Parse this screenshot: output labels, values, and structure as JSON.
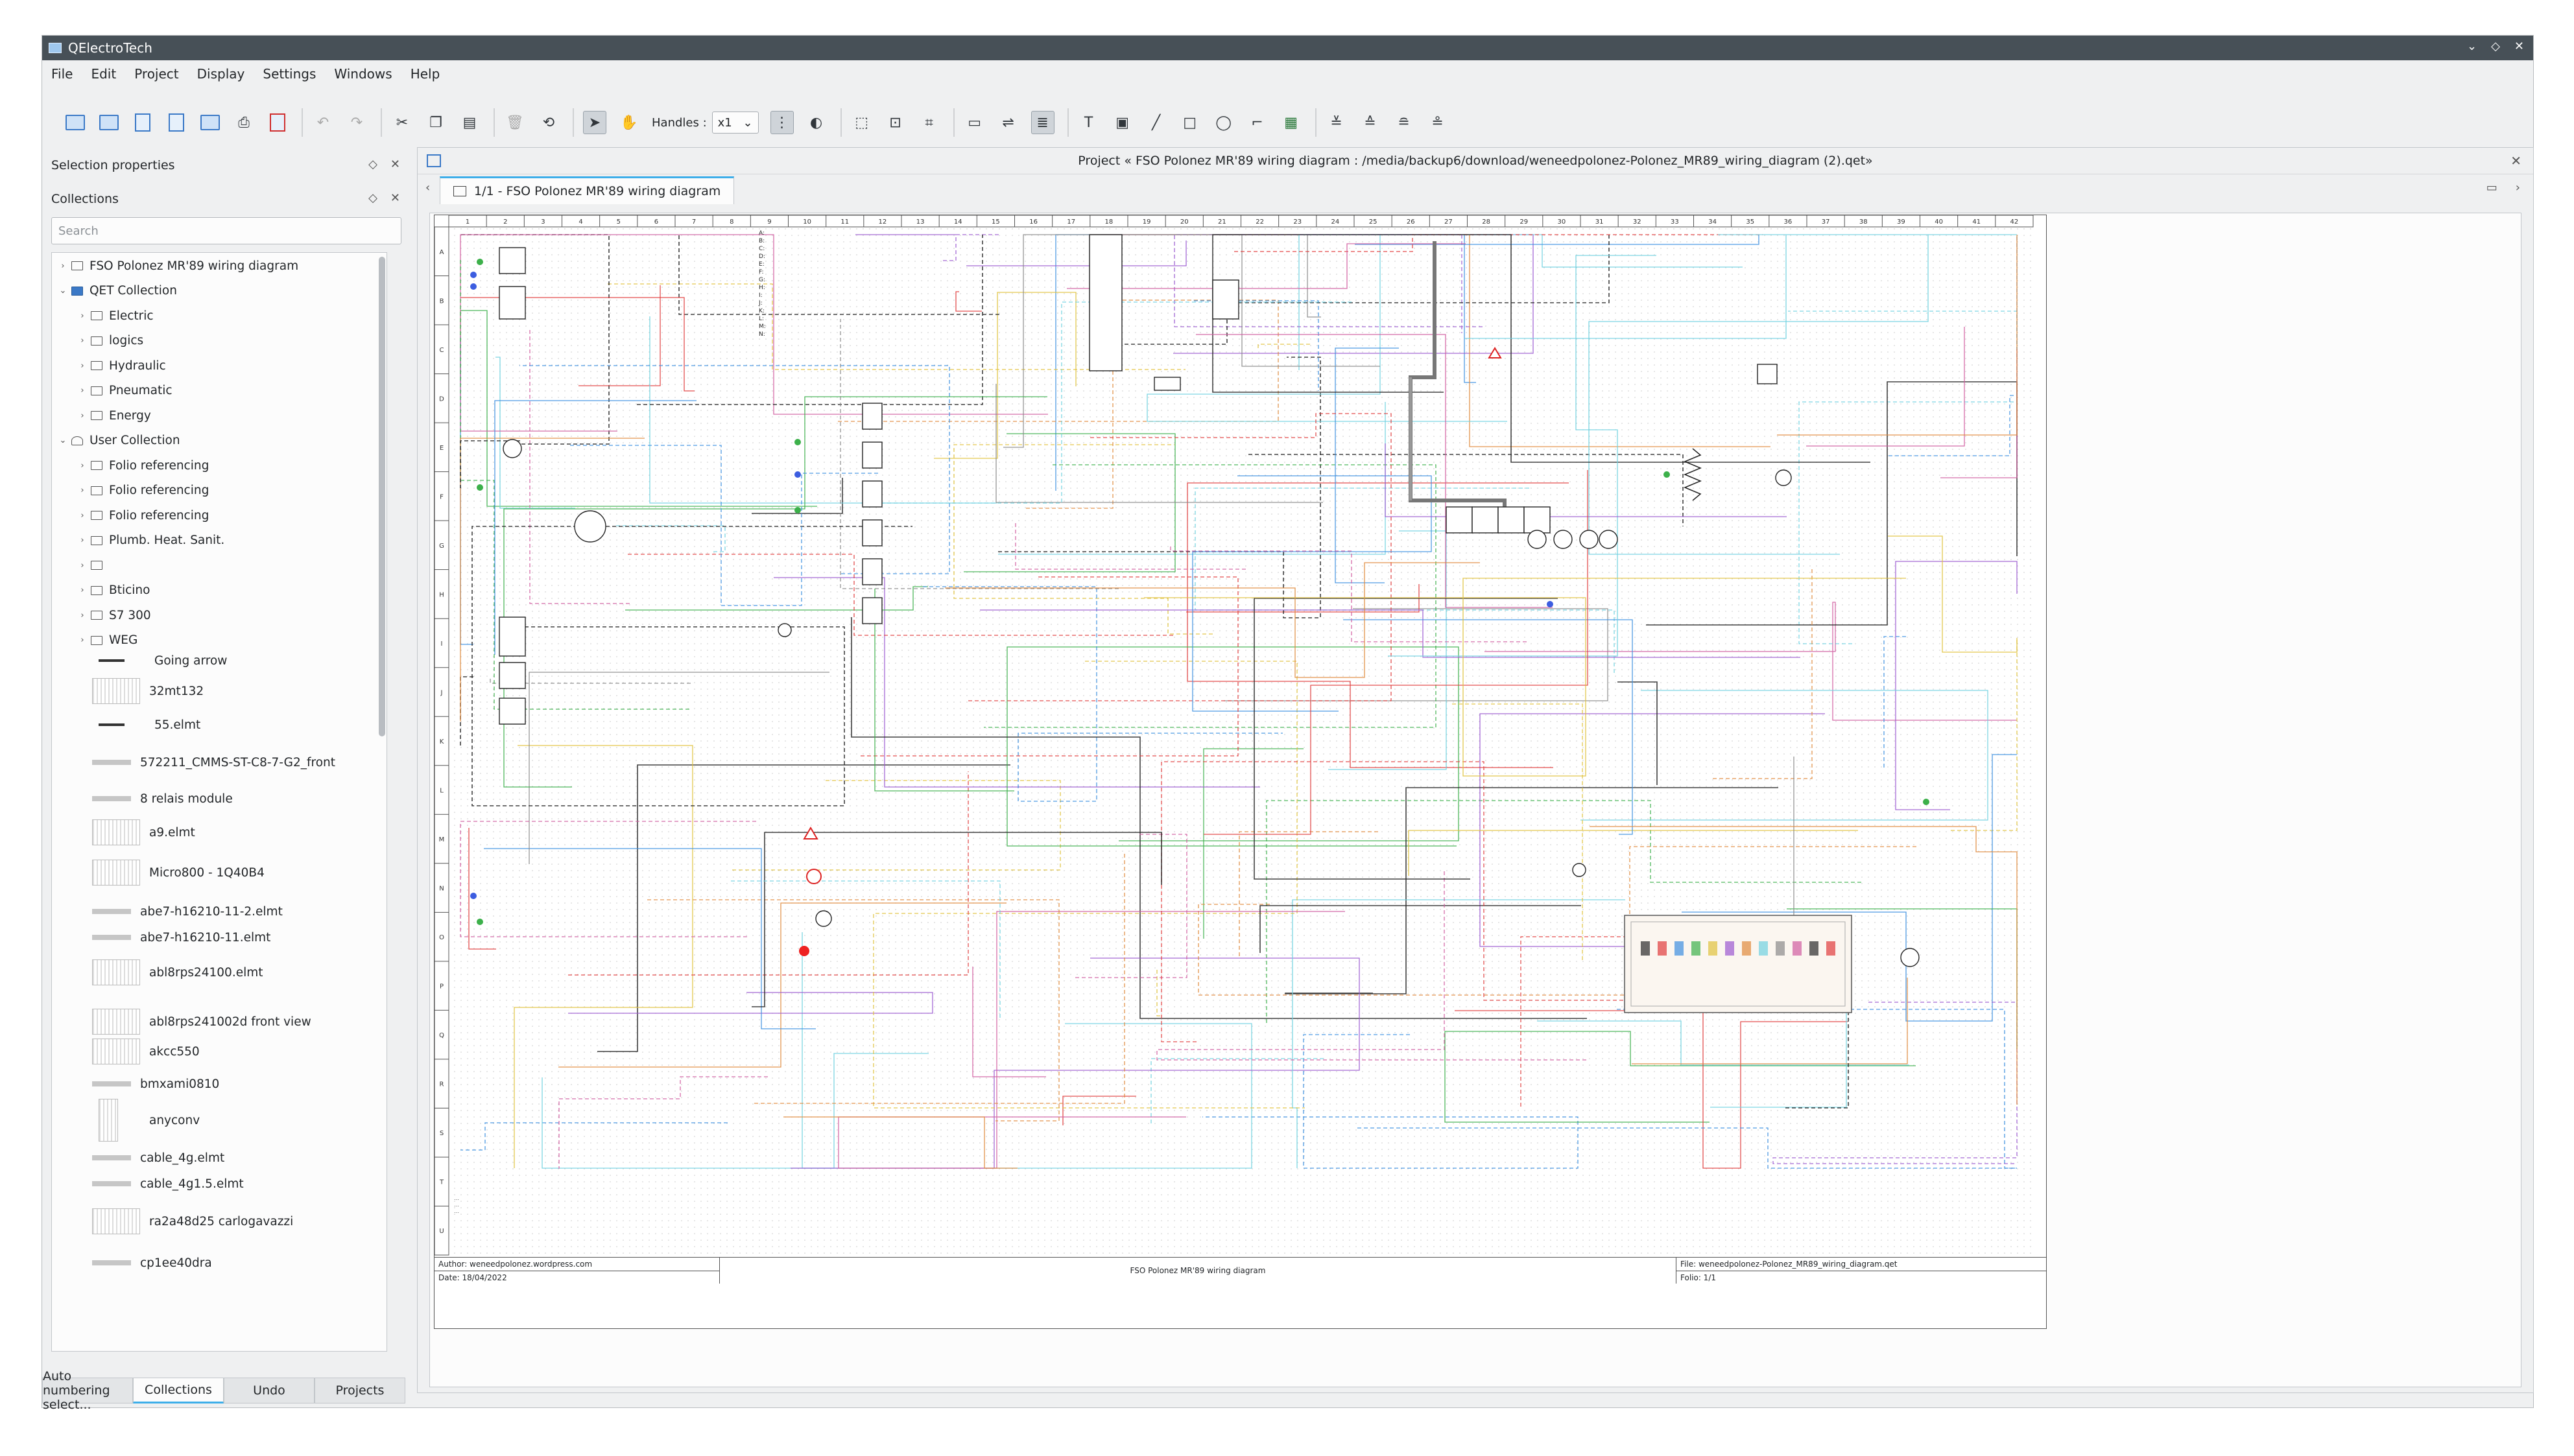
{
  "app": {
    "title": "QElectroTech"
  },
  "window_controls": [
    "⌄",
    "◇",
    "✕"
  ],
  "menu": [
    "File",
    "Edit",
    "Project",
    "Display",
    "Settings",
    "Windows",
    "Help"
  ],
  "toolbar": {
    "handles_label": "Handles :",
    "handles_value": "x1"
  },
  "dock": {
    "selection_title": "Selection properties",
    "collections_title": "Collections",
    "search_placeholder": "Search"
  },
  "tree": [
    {
      "level": 0,
      "arrow": "›",
      "icon": "folder",
      "label": "FSO Polonez MR'89 wiring diagram"
    },
    {
      "level": 0,
      "arrow": "⌄",
      "icon": "qet",
      "label": "QET Collection"
    },
    {
      "level": 1,
      "arrow": "›",
      "icon": "folder",
      "label": "Electric"
    },
    {
      "level": 1,
      "arrow": "›",
      "icon": "folder",
      "label": "logics"
    },
    {
      "level": 1,
      "arrow": "›",
      "icon": "folder",
      "label": "Hydraulic"
    },
    {
      "level": 1,
      "arrow": "›",
      "icon": "folder",
      "label": "Pneumatic"
    },
    {
      "level": 1,
      "arrow": "›",
      "icon": "folder",
      "label": "Energy"
    },
    {
      "level": 0,
      "arrow": "⌄",
      "icon": "user",
      "label": "User Collection"
    },
    {
      "level": 1,
      "arrow": "›",
      "icon": "folder",
      "label": "Folio referencing"
    },
    {
      "level": 1,
      "arrow": "›",
      "icon": "folder",
      "label": "Folio referencing"
    },
    {
      "level": 1,
      "arrow": "›",
      "icon": "folder",
      "label": "Folio referencing"
    },
    {
      "level": 1,
      "arrow": "›",
      "icon": "folder",
      "label": "Plumb. Heat. Sanit."
    },
    {
      "level": 1,
      "arrow": "›",
      "icon": "folder",
      "label": ""
    },
    {
      "level": 1,
      "arrow": "›",
      "icon": "folder",
      "label": "Bticino"
    },
    {
      "level": 1,
      "arrow": "›",
      "icon": "folder",
      "label": "S7 300"
    },
    {
      "level": 1,
      "arrow": "›",
      "icon": "folder",
      "label": "WEG"
    }
  ],
  "elements": [
    {
      "label": "Going arrow",
      "thumb": "arrow"
    },
    {
      "label": "32mt132",
      "thumb": "big"
    },
    {
      "label": "55.elmt",
      "thumb": "arrow"
    },
    {
      "label": "572211_CMMS-ST-C8-7-G2_front",
      "thumb": "line"
    },
    {
      "label": "8 relais module",
      "thumb": "small"
    },
    {
      "label": "a9.elmt",
      "thumb": "big"
    },
    {
      "label": "Micro800 - 1Q40B4",
      "thumb": "big"
    },
    {
      "label": "abe7-h16210-11-2.elmt",
      "thumb": "small"
    },
    {
      "label": "abe7-h16210-11.elmt",
      "thumb": "small"
    },
    {
      "label": "abl8rps24100.elmt",
      "thumb": "big"
    },
    {
      "label": "abl8rps241002d front view",
      "thumb": "big"
    },
    {
      "label": "akcc550",
      "thumb": "big"
    },
    {
      "label": "bmxami0810",
      "thumb": "small"
    },
    {
      "label": "anyconv",
      "thumb": "tall"
    },
    {
      "label": "cable_4g.elmt",
      "thumb": "small"
    },
    {
      "label": "cable_4g1.5.elmt",
      "thumb": "small"
    },
    {
      "label": "ra2a48d25 carlogavazzi",
      "thumb": "big"
    },
    {
      "label": "cp1ee40dra",
      "thumb": "small"
    }
  ],
  "bottom_tabs": [
    "Auto numbering select...",
    "Collections",
    "Undo",
    "Projects"
  ],
  "project": {
    "header": "Project « FSO Polonez MR'89 wiring diagram : /media/backup6/download/weneedpolonez-Polonez_MR89_wiring_diagram (2).qet»",
    "folio_tab": "1/1 - FSO Polonez MR'89 wiring diagram"
  },
  "sheet": {
    "columns": [
      "1",
      "2",
      "3",
      "4",
      "5",
      "6",
      "7",
      "8",
      "9",
      "10",
      "11",
      "12",
      "13",
      "14",
      "15",
      "16",
      "17",
      "18",
      "19",
      "20",
      "21",
      "22",
      "23",
      "24",
      "25",
      "26",
      "27",
      "28",
      "29",
      "30",
      "31",
      "32",
      "33",
      "34",
      "35",
      "36",
      "37",
      "38",
      "39",
      "40",
      "41",
      "42"
    ],
    "rows": [
      "A",
      "B",
      "C",
      "D",
      "E",
      "F",
      "G",
      "H",
      "I",
      "J",
      "K",
      "L",
      "M",
      "N",
      "O",
      "P",
      "Q",
      "R",
      "S",
      "T",
      "U"
    ],
    "legend_keys": [
      "A:",
      "B:",
      "C:",
      "D:",
      "E:",
      "F:",
      "G:",
      "H:",
      "I:",
      "J:",
      "K:",
      "L:",
      "M:",
      "N:"
    ]
  },
  "footer": {
    "author": "Author: weneedpolonez.wordpress.com",
    "date": "Date: 18/04/2022",
    "title": "FSO Polonez MR'89 wiring diagram",
    "file": "File: weneedpolonez-Polonez_MR89_wiring_diagram.qet",
    "folio": "Folio: 1/1"
  },
  "wire_colors": [
    "#2b2b2b",
    "#e03c3c",
    "#3c8fe0",
    "#3cb04a",
    "#e0c23c",
    "#9b59d0",
    "#e08a3c",
    "#6fd2e0",
    "#8a8a8a",
    "#d05ca0"
  ]
}
